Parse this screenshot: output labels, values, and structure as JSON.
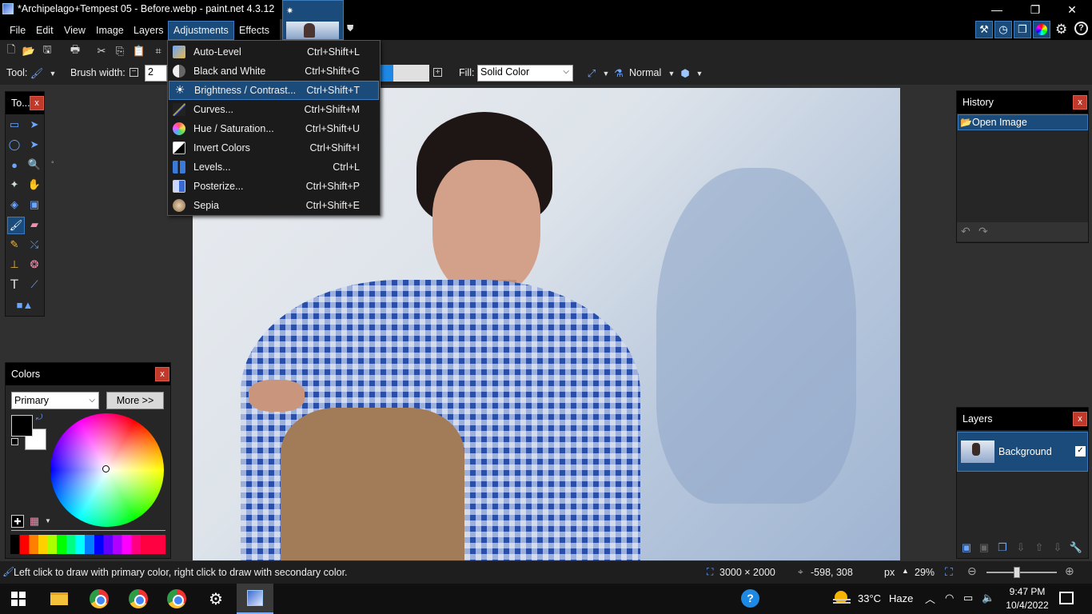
{
  "window": {
    "title": "*Archipelago+Tempest 05 - Before.webp - paint.net 4.3.12",
    "minimize": "—",
    "restore": "❐",
    "close": "✕"
  },
  "menubar": {
    "items": [
      "File",
      "Edit",
      "View",
      "Image",
      "Layers",
      "Adjustments",
      "Effects"
    ]
  },
  "toolbar": {
    "tool_label": "Tool:",
    "brush_width_label": "Brush width:",
    "brush_width_value": "2",
    "fill_label": "Fill:",
    "fill_value": "Solid Color",
    "blend_mode": "Normal"
  },
  "adjustments_menu": [
    {
      "label": "Auto-Level",
      "shortcut": "Ctrl+Shift+L",
      "icon": "auto-level-icon"
    },
    {
      "label": "Black and White",
      "shortcut": "Ctrl+Shift+G",
      "icon": "black-and-white-icon"
    },
    {
      "label": "Brightness / Contrast...",
      "shortcut": "Ctrl+Shift+T",
      "icon": "brightness-icon"
    },
    {
      "label": "Curves...",
      "shortcut": "Ctrl+Shift+M",
      "icon": "curves-icon"
    },
    {
      "label": "Hue / Saturation...",
      "shortcut": "Ctrl+Shift+U",
      "icon": "hue-saturation-icon"
    },
    {
      "label": "Invert Colors",
      "shortcut": "Ctrl+Shift+I",
      "icon": "invert-colors-icon"
    },
    {
      "label": "Levels...",
      "shortcut": "Ctrl+L",
      "icon": "levels-icon"
    },
    {
      "label": "Posterize...",
      "shortcut": "Ctrl+Shift+P",
      "icon": "posterize-icon"
    },
    {
      "label": "Sepia",
      "shortcut": "Ctrl+Shift+E",
      "icon": "sepia-icon"
    }
  ],
  "tools_panel": {
    "title": "To..."
  },
  "colors_panel": {
    "title": "Colors",
    "mode": "Primary",
    "more_button": "More >>"
  },
  "history_panel": {
    "title": "History",
    "items": [
      "Open Image"
    ]
  },
  "layers_panel": {
    "title": "Layers",
    "layers": [
      {
        "name": "Background",
        "visible": true
      }
    ]
  },
  "statusbar": {
    "hint": "Left click to draw with primary color, right click to draw with secondary color.",
    "image_size": "3000 × 2000",
    "cursor_pos": "-598, 308",
    "unit": "px",
    "zoom": "29%"
  },
  "taskbar": {
    "weather": "33°C",
    "weather_desc": "Haze",
    "time": "9:47 PM",
    "date": "10/4/2022",
    "help": "?"
  },
  "colors": {
    "accent": "#1a4b7a",
    "accent_border": "#3d7bbf",
    "close_red": "#c0392b"
  }
}
